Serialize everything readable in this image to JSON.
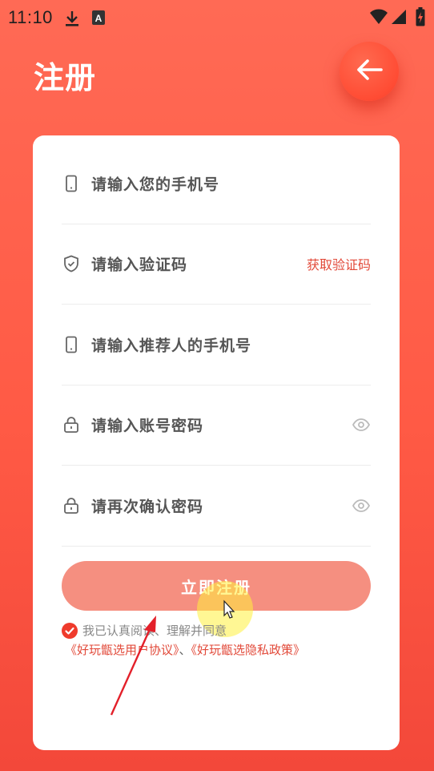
{
  "status_bar": {
    "time": "11:10",
    "icons": [
      "download-icon",
      "app-a-icon",
      "wifi-icon",
      "signal-icon",
      "battery-charging-icon"
    ]
  },
  "header": {
    "title": "注册",
    "back_icon": "arrow-left-icon"
  },
  "form": {
    "fields": [
      {
        "placeholder": "请输入您的手机号",
        "icon": "phone-icon"
      },
      {
        "placeholder": "请输入验证码",
        "icon": "shield-check-icon",
        "action_label": "获取验证码"
      },
      {
        "placeholder": "请输入推荐人的手机号",
        "icon": "phone-icon"
      },
      {
        "placeholder": "请输入账号密码",
        "icon": "lock-icon",
        "toggle_icon": "eye-icon"
      },
      {
        "placeholder": "请再次确认密码",
        "icon": "lock-icon",
        "toggle_icon": "eye-icon"
      }
    ],
    "submit_label": "立即注册",
    "agreement": {
      "checked": true,
      "text": "我已认真阅读、理解并同意",
      "user_agreement": "《好玩甑选用户协议》",
      "separator": "、",
      "privacy_policy": "《好玩甑选隐私政策》"
    }
  },
  "colors": {
    "primary": "#ff5a45",
    "button": "#f58f80",
    "link": "#e24a3a"
  }
}
